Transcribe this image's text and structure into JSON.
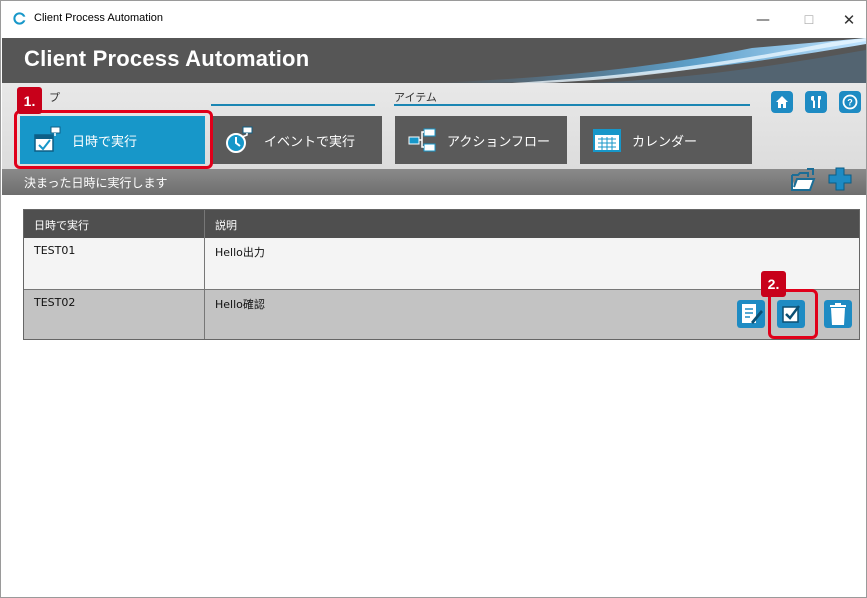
{
  "window": {
    "title": "Client Process Automation",
    "minimize": "—",
    "maximize": "☐",
    "close": "✕"
  },
  "header": {
    "app_title": "Client Process Automation"
  },
  "groups": {
    "group1_label": "プ",
    "group2_label": "アイテム"
  },
  "nav": [
    {
      "label": "日時で実行",
      "active": true
    },
    {
      "label": "イベントで実行",
      "active": false
    },
    {
      "label": "アクションフロー",
      "active": false
    },
    {
      "label": "カレンダー",
      "active": false
    }
  ],
  "status_text": "決まった日時に実行します",
  "table": {
    "headers": [
      "日時で実行",
      "説明"
    ],
    "rows": [
      {
        "name": "TEST01",
        "description": "Hello出力"
      },
      {
        "name": "TEST02",
        "description": "Hello確認"
      }
    ]
  },
  "callouts": {
    "step1": "1.",
    "step2": "2."
  },
  "colors": {
    "accent": "#1797c9",
    "highlight": "#e0001a",
    "header_bg": "#565656"
  }
}
